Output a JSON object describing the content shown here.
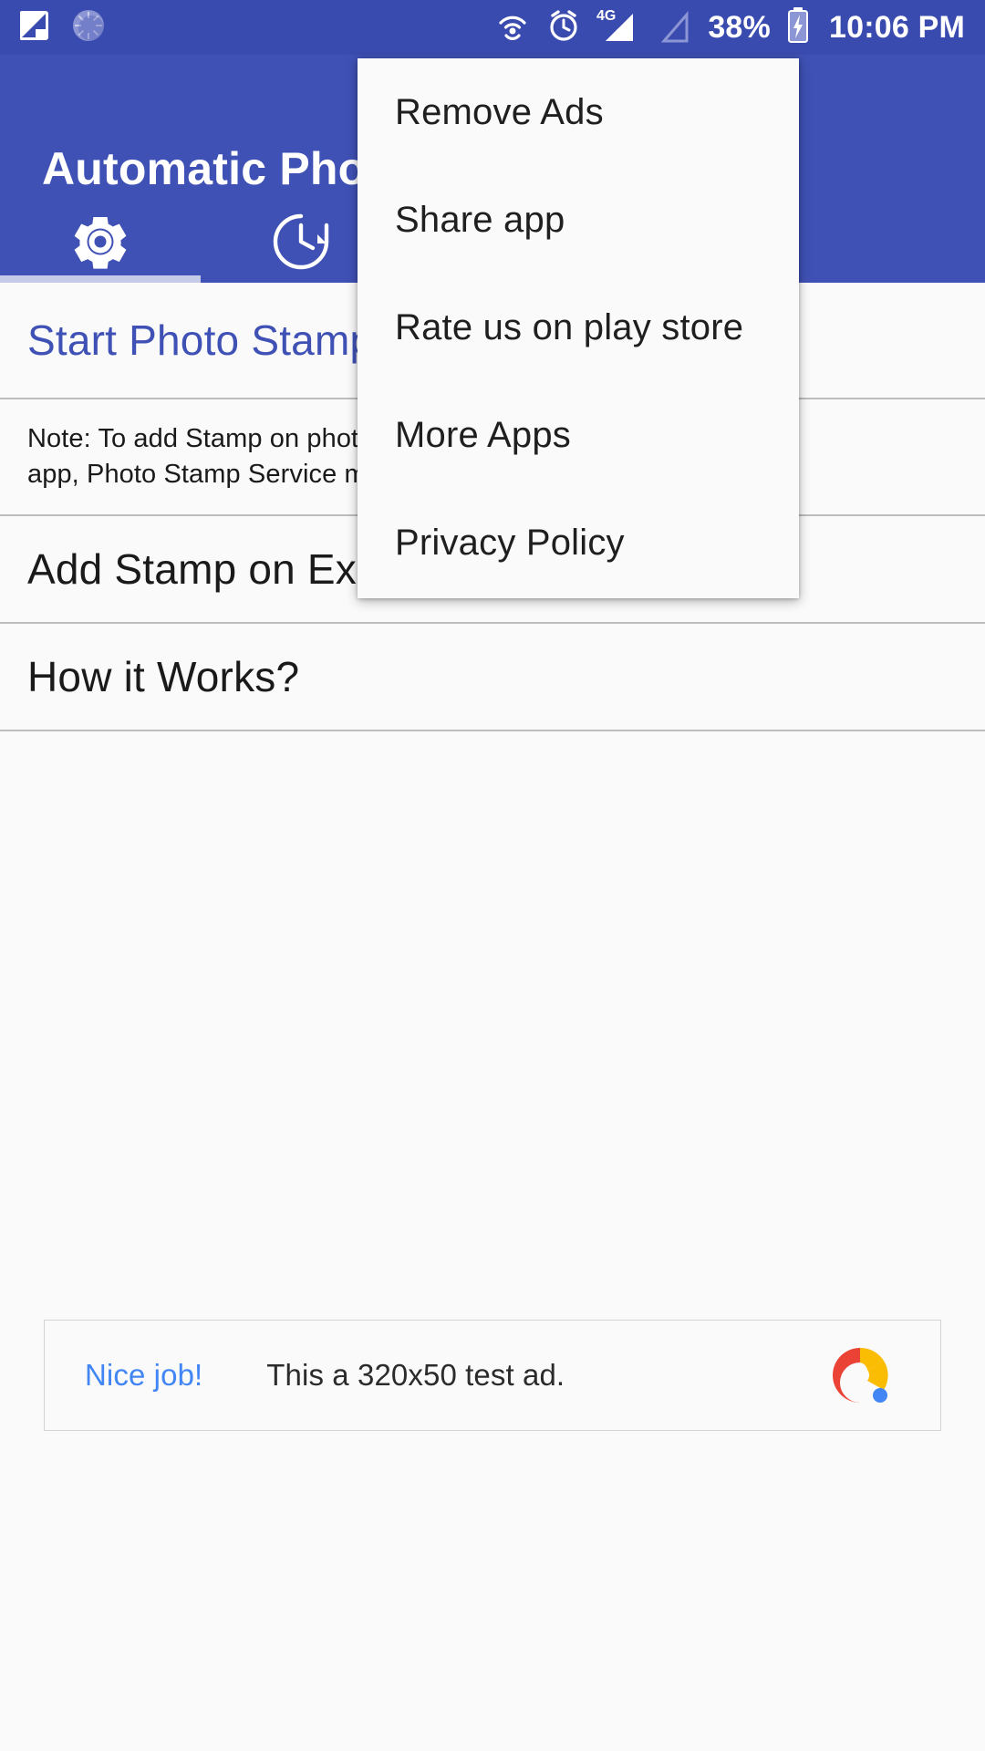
{
  "status_bar": {
    "icons_left": [
      "screenshot-icon",
      "sync-spinner-icon"
    ],
    "icons_right": [
      "cast-icon",
      "alarm-icon",
      "signal-4g-icon",
      "signal-empty-icon"
    ],
    "network_label": "4G",
    "battery_percent": "38%",
    "battery_icon": "battery-charging-icon",
    "clock": "10:06 PM"
  },
  "appbar": {
    "title": "Automatic Photo Stamp",
    "background": "#3F51B5",
    "tabs": [
      {
        "icon": "gear-icon",
        "name": "settings",
        "selected": true
      },
      {
        "icon": "clock-history-icon",
        "name": "history",
        "selected": false
      }
    ]
  },
  "overflow_menu": {
    "visible": true,
    "items": [
      {
        "label": "Remove Ads"
      },
      {
        "label": "Share app"
      },
      {
        "label": "Rate us on play store"
      },
      {
        "label": "More Apps"
      },
      {
        "label": "Privacy Policy"
      }
    ]
  },
  "main": {
    "rows": [
      {
        "id": "start-photo-stamp",
        "label": "Start Photo Stamp Service",
        "style": "primary"
      },
      {
        "id": "note",
        "label": "Note: To add Stamp on photos taken from Camera\napp, Photo Stamp Service must be running.",
        "style": "note"
      },
      {
        "id": "add-stamp-existing",
        "label": "Add Stamp on Existing Photos",
        "style": "default"
      },
      {
        "id": "how-it-works",
        "label": "How it Works?",
        "style": "default"
      }
    ]
  },
  "ad": {
    "cta": "Nice job!",
    "text": "This a 320x50 test ad.",
    "logo": "admob-icon",
    "colors": {
      "cta": "#4285F4",
      "logo_red": "#EA4335",
      "logo_yellow": "#FBBC04",
      "logo_blue": "#4285F4"
    }
  },
  "colors": {
    "primary": "#3F51B5",
    "status_bar": "#3A4BAF",
    "accent_text": "#3F51B5",
    "surface": "#FAFAFA",
    "divider": "#BDBDBD",
    "tab_indicator": "#C5CAE9"
  }
}
